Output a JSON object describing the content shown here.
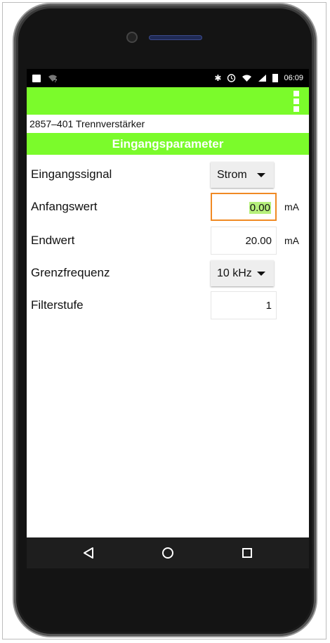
{
  "statusbar": {
    "left_icons": [
      "image-icon",
      "wifi-unknown-icon"
    ],
    "right_icons": [
      "bluetooth-icon",
      "alarm-icon",
      "wifi-icon",
      "signal-icon",
      "battery-icon"
    ],
    "time": "06:09"
  },
  "app": {
    "device_title": "2857–401 Trennverstärker",
    "section_header": "Eingangsparameter",
    "accent_color": "#7bfb2b"
  },
  "params": {
    "eingangssignal": {
      "label": "Eingangssignal",
      "value": "Strom"
    },
    "anfangswert": {
      "label": "Anfangswert",
      "value": "0.00",
      "unit": "mA"
    },
    "endwert": {
      "label": "Endwert",
      "value": "20.00",
      "unit": "mA"
    },
    "grenzfrequenz": {
      "label": "Grenzfrequenz",
      "value": "10 kHz"
    },
    "filterstufe": {
      "label": "Filterstufe",
      "value": "1"
    }
  },
  "navbar": {
    "buttons": [
      "back-icon",
      "home-icon",
      "recents-icon"
    ]
  }
}
